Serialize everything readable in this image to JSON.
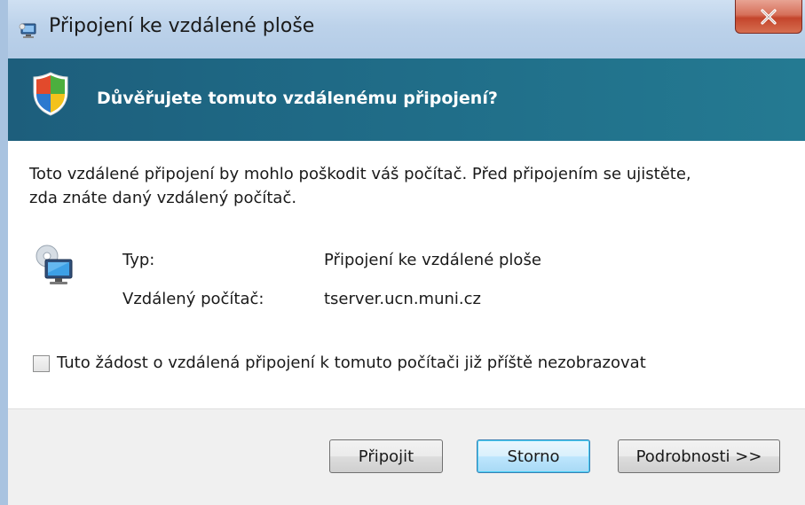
{
  "window": {
    "title": "Připojení ke vzdálené ploše",
    "close_icon": "close-icon"
  },
  "header": {
    "icon": "security-shield-icon",
    "text": "Důvěřujete tomuto vzdálenému připojení?"
  },
  "content": {
    "message_line1": "Toto vzdálené připojení by mohlo poškodit váš počítač. Před připojením se ujistěte,",
    "message_line2": "zda znáte daný vzdálený počítač.",
    "icon": "remote-computer-icon",
    "rows": [
      {
        "label": "Typ:",
        "value": "Připojení ke vzdálené ploše"
      },
      {
        "label": "Vzdálený počítač:",
        "value": "tserver.ucn.muni.cz"
      }
    ],
    "checkbox": {
      "label": "Tuto žádost o vzdálená připojení k tomuto počítači již příště nezobrazovat",
      "checked": false
    }
  },
  "buttons": {
    "connect": "Připojit",
    "cancel": "Storno",
    "details": "Podrobnosti >>"
  },
  "colors": {
    "header_band": "#1f6a86",
    "header_text": "#ffffff",
    "primary_button_border": "#3c7fb1"
  }
}
